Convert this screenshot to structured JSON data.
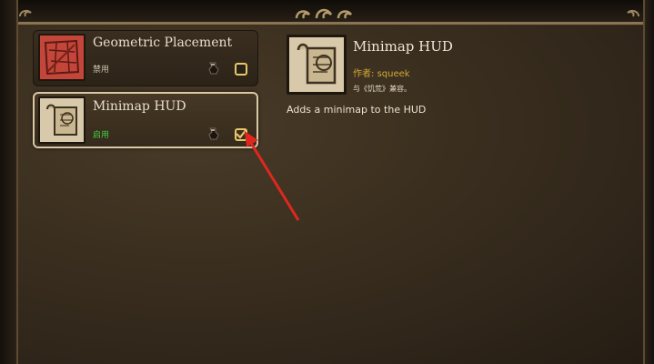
{
  "mods": [
    {
      "title": "Geometric Placement",
      "status": "禁用",
      "enabled": false,
      "icon": "map-grid-icon"
    },
    {
      "title": "Minimap HUD",
      "status": "启用",
      "enabled": true,
      "icon": "scroll-map-icon"
    }
  ],
  "detail": {
    "title": "Minimap HUD",
    "author_label": "作者:",
    "author_name": "squeek",
    "compat": "与《饥荒》兼容。",
    "description": "Adds a minimap to the HUD",
    "icon": "scroll-map-icon"
  },
  "colors": {
    "enabled_green": "#3fd13f",
    "author_gold": "#d6a838",
    "checkbox_gold": "#e5c86a",
    "annotation_red": "#e0271f"
  }
}
